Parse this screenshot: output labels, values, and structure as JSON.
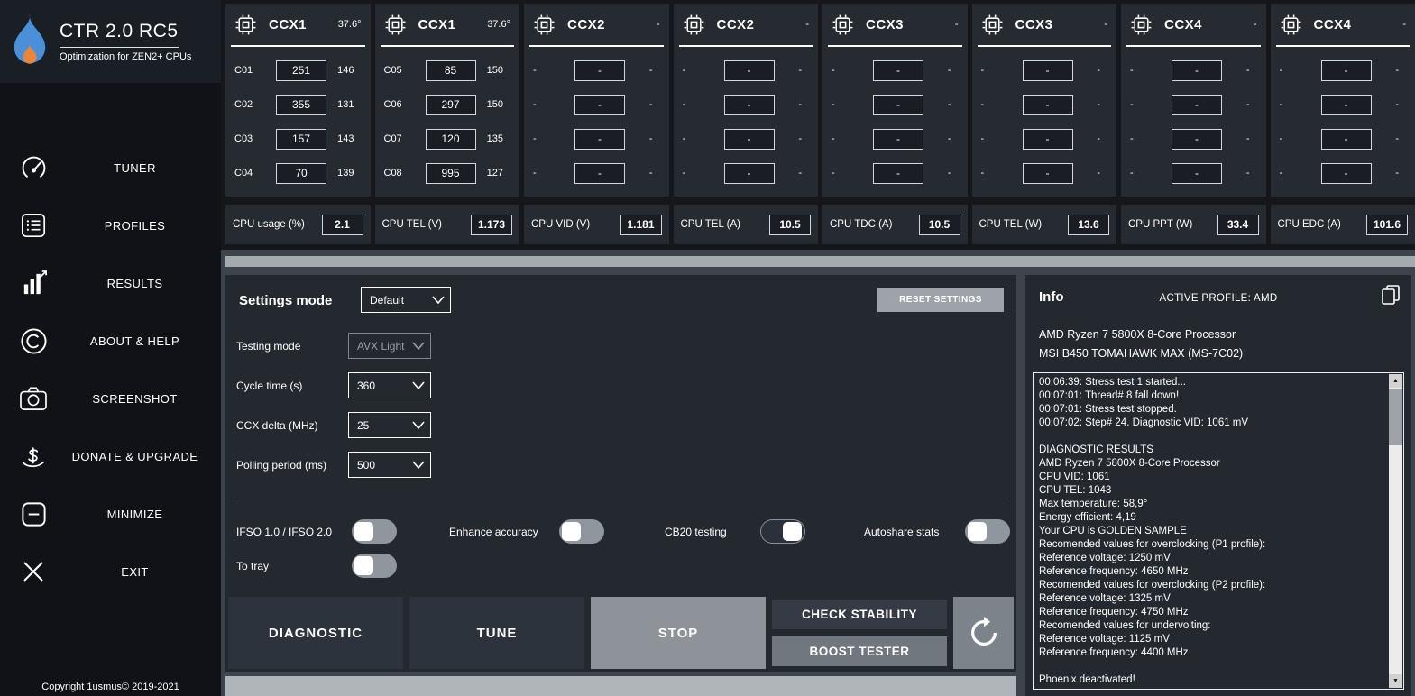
{
  "sidebar": {
    "title": "CTR 2.0 RC5",
    "subtitle": "Optimization for ZEN2+ CPUs",
    "items": [
      {
        "icon": "gauge-icon",
        "label": "TUNER"
      },
      {
        "icon": "list-icon",
        "label": "PROFILES"
      },
      {
        "icon": "bar-chart-icon",
        "label": "RESULTS"
      },
      {
        "icon": "copyright-icon",
        "label": "ABOUT & HELP"
      },
      {
        "icon": "camera-icon",
        "label": "SCREENSHOT"
      },
      {
        "icon": "donate-icon",
        "label": "DONATE & UPGRADE"
      },
      {
        "icon": "minimize-icon",
        "label": "MINIMIZE"
      },
      {
        "icon": "close-icon",
        "label": "EXIT"
      }
    ],
    "copyright": "Copyright 1usmus© 2019-2021"
  },
  "ccx_panels": [
    {
      "title": "CCX1",
      "temp": "37.6°",
      "rows": [
        [
          "C01",
          "251",
          "146"
        ],
        [
          "C02",
          "355",
          "131"
        ],
        [
          "C03",
          "157",
          "143"
        ],
        [
          "C04",
          "70",
          "139"
        ]
      ]
    },
    {
      "title": "CCX1",
      "temp": "37.6°",
      "rows": [
        [
          "C05",
          "85",
          "150"
        ],
        [
          "C06",
          "297",
          "150"
        ],
        [
          "C07",
          "120",
          "135"
        ],
        [
          "C08",
          "995",
          "127"
        ]
      ]
    },
    {
      "title": "CCX2",
      "temp": "-",
      "rows": [
        [
          "-",
          "-",
          "-"
        ],
        [
          "-",
          "-",
          "-"
        ],
        [
          "-",
          "-",
          "-"
        ],
        [
          "-",
          "-",
          "-"
        ]
      ]
    },
    {
      "title": "CCX2",
      "temp": "-",
      "rows": [
        [
          "-",
          "-",
          "-"
        ],
        [
          "-",
          "-",
          "-"
        ],
        [
          "-",
          "-",
          "-"
        ],
        [
          "-",
          "-",
          "-"
        ]
      ]
    },
    {
      "title": "CCX3",
      "temp": "-",
      "rows": [
        [
          "-",
          "-",
          "-"
        ],
        [
          "-",
          "-",
          "-"
        ],
        [
          "-",
          "-",
          "-"
        ],
        [
          "-",
          "-",
          "-"
        ]
      ]
    },
    {
      "title": "CCX3",
      "temp": "-",
      "rows": [
        [
          "-",
          "-",
          "-"
        ],
        [
          "-",
          "-",
          "-"
        ],
        [
          "-",
          "-",
          "-"
        ],
        [
          "-",
          "-",
          "-"
        ]
      ]
    },
    {
      "title": "CCX4",
      "temp": "-",
      "rows": [
        [
          "-",
          "-",
          "-"
        ],
        [
          "-",
          "-",
          "-"
        ],
        [
          "-",
          "-",
          "-"
        ],
        [
          "-",
          "-",
          "-"
        ]
      ]
    },
    {
      "title": "CCX4",
      "temp": "-",
      "rows": [
        [
          "-",
          "-",
          "-"
        ],
        [
          "-",
          "-",
          "-"
        ],
        [
          "-",
          "-",
          "-"
        ],
        [
          "-",
          "-",
          "-"
        ]
      ]
    }
  ],
  "stats": [
    {
      "label": "CPU usage (%)",
      "value": "2.1"
    },
    {
      "label": "CPU TEL (V)",
      "value": "1.173"
    },
    {
      "label": "CPU VID (V)",
      "value": "1.181"
    },
    {
      "label": "CPU TEL (A)",
      "value": "10.5"
    },
    {
      "label": "CPU TDC (A)",
      "value": "10.5"
    },
    {
      "label": "CPU TEL (W)",
      "value": "13.6"
    },
    {
      "label": "CPU PPT (W)",
      "value": "33.4"
    },
    {
      "label": "CPU EDC (A)",
      "value": "101.6"
    }
  ],
  "settings": {
    "mode_label": "Settings mode",
    "mode_value": "Default",
    "reset_button": "RESET SETTINGS",
    "fields": [
      {
        "label": "Testing mode",
        "value": "AVX Light",
        "disabled": true
      },
      {
        "label": "Cycle time (s)",
        "value": "360",
        "disabled": false
      },
      {
        "label": "CCX delta (MHz)",
        "value": "25",
        "disabled": false
      },
      {
        "label": "Polling period (ms)",
        "value": "500",
        "disabled": false
      }
    ],
    "toggles": [
      {
        "label": "IFSO 1.0 / IFSO 2.0",
        "on": false
      },
      {
        "label": "Enhance accuracy",
        "on": false
      },
      {
        "label": "CB20 testing",
        "on": true
      },
      {
        "label": "Autoshare stats",
        "on": false
      },
      {
        "label": "To tray",
        "on": false
      }
    ],
    "buttons": {
      "diagnostic": "DIAGNOSTIC",
      "tune": "TUNE",
      "stop": "STOP",
      "check_stability": "CHECK STABILITY",
      "boost_tester": "BOOST TESTER",
      "refresh_icon": "refresh-icon"
    }
  },
  "info": {
    "title": "Info",
    "active_profile": "ACTIVE PROFILE: AMD",
    "copy_icon": "copy-icon",
    "cpu_name": "AMD Ryzen 7 5800X 8-Core Processor",
    "motherboard": "MSI B450 TOMAHAWK MAX (MS-7C02)",
    "log_lines": [
      "00:06:39: Stress test 1 started...",
      "00:07:01: Thread# 8 fall down!",
      "00:07:01: Stress test stopped.",
      "00:07:02: Step# 24. Diagnostic VID: 1061 mV",
      "",
      "DIAGNOSTIC RESULTS",
      "AMD Ryzen 7 5800X 8-Core Processor",
      "CPU VID: 1061",
      "CPU TEL: 1043",
      "Max temperature: 58,9°",
      "Energy efficient: 4,19",
      "Your CPU is GOLDEN SAMPLE",
      "Recomended values for overclocking (P1 profile):",
      "Reference voltage: 1250 mV",
      "Reference frequency: 4650 MHz",
      "Recomended values for overclocking (P2 profile):",
      "Reference voltage: 1325 mV",
      "Reference frequency: 4750 MHz",
      "Recomended values for undervolting:",
      "Reference voltage: 1125 mV",
      "Reference frequency: 4400 MHz",
      "",
      "Phoenix deactivated!"
    ]
  },
  "colors": {
    "flame_blue": "#4a8fd8",
    "flame_orange": "#e8873c",
    "panel_bg": "#242930",
    "toggle_off": "#8f969d",
    "strip": "#a5aaaf"
  }
}
